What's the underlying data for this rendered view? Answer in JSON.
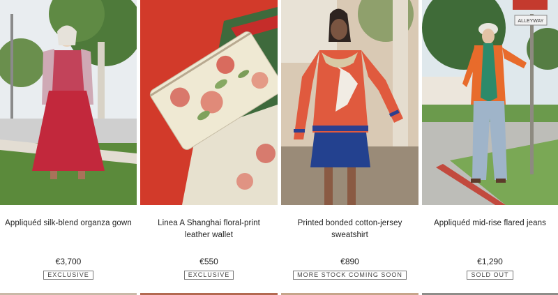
{
  "products": [
    {
      "title": "Appliquéd silk-blend organza gown",
      "price": "€3,700",
      "badge": "EXCLUSIVE",
      "image": "model-red-gown-photo"
    },
    {
      "title": "Linea A Shanghai floral-print leather wallet",
      "price": "€550",
      "badge": "EXCLUSIVE",
      "image": "floral-wallet-photo"
    },
    {
      "title": "Printed bonded cotton-jersey sweatshirt",
      "price": "€890",
      "badge": "MORE STOCK COMING SOON",
      "image": "model-crane-sweatshirt-photo"
    },
    {
      "title": "Appliquéd mid-rise flared jeans",
      "price": "€1,290",
      "badge": "SOLD OUT",
      "image": "model-flared-jeans-photo"
    }
  ],
  "photo_street_sign": "ALLEYWAY",
  "colors": {
    "text": "#222222",
    "badge_border": "#777777",
    "background": "#ffffff"
  }
}
